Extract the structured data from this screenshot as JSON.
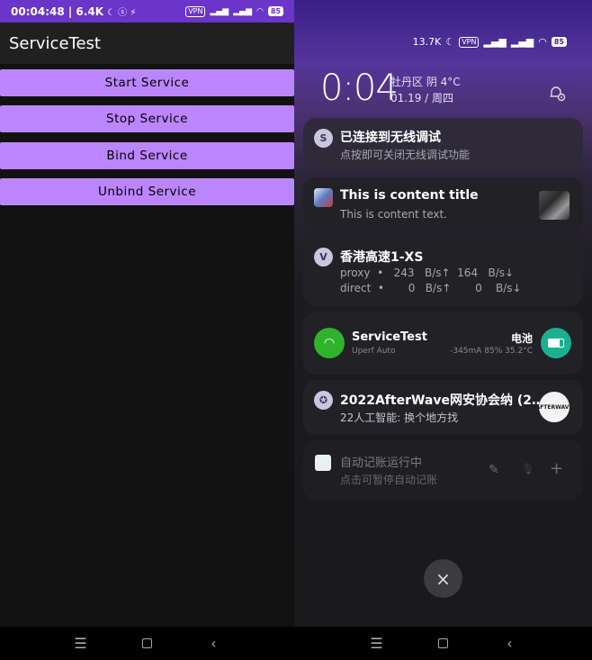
{
  "left": {
    "status": {
      "time": "00:04:48 | 6.4K",
      "icons": [
        "moon-icon",
        "hotspot-icon",
        "vibrate-off-icon"
      ],
      "vpn": "VPN",
      "signal1": "5G",
      "signal2": "4G",
      "battery": "85"
    },
    "app_title": "ServiceTest",
    "buttons": {
      "start": "Start Service",
      "stop": "Stop Service",
      "bind": "Bind Service",
      "unbind": "Unbind Service"
    },
    "nav": {
      "menu": "☰",
      "back": "‹"
    }
  },
  "right": {
    "status": {
      "speed": "13.7K",
      "vpn": "VPN",
      "signal1": "5G",
      "signal2": "4G",
      "battery": "85"
    },
    "clock": "0:04",
    "weather_line1": "牡丹区 阴 4°C",
    "weather_line2": "01.19 / 周四",
    "notifications": {
      "adb": {
        "icon": "S",
        "title": "已连接到无线调试",
        "text": "点按即可关闭无线调试功能"
      },
      "content": {
        "title": "This is content title",
        "text": "This is content text."
      },
      "proxy": {
        "icon": "V",
        "title": "香港高速1-XS",
        "line1": "proxy  •   243   B/s↑  164   B/s↓",
        "line2": "direct  •       0   B/s↑       0    B/s↓"
      },
      "servicetest": {
        "title": "ServiceTest",
        "sub": "Uperf Auto",
        "battery_label": "电池",
        "battery_detail": "-345mA 85% 35.2°C"
      },
      "afterwave": {
        "icon": "✪",
        "title": "2022AfterWave网安协会纳 (2…",
        "text": "22人工智能: 换个地方找",
        "logo": "AFTERWAVE"
      },
      "bookkeeping": {
        "title": "自动记账运行中",
        "text": "点击可暂停自动记账",
        "edit": "✎",
        "mic": "🎙",
        "add": "+"
      }
    },
    "close": "×",
    "nav": {
      "menu": "☰",
      "back": "‹"
    }
  },
  "colors": {
    "accent": "#bb86fc",
    "status_bar": "#6a35c8"
  }
}
